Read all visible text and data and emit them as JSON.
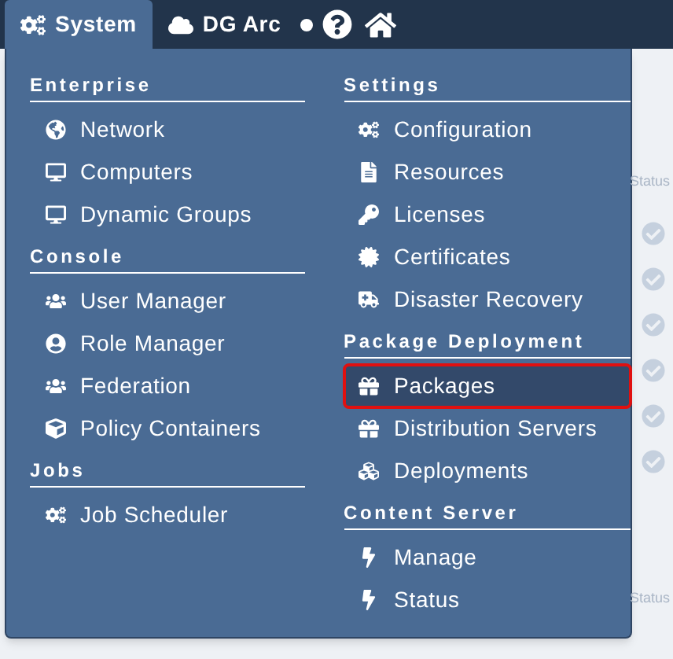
{
  "top_bar": {
    "items": [
      {
        "label": "System",
        "selected": true
      },
      {
        "label": "DG Arc",
        "selected": false
      }
    ]
  },
  "menu": {
    "columns": [
      [
        {
          "heading": "Enterprise",
          "items": [
            {
              "label": "Network",
              "selected": false,
              "outlined": false
            },
            {
              "label": "Computers",
              "selected": false,
              "outlined": false
            },
            {
              "label": "Dynamic Groups",
              "selected": false,
              "outlined": false
            }
          ]
        },
        {
          "heading": "Console",
          "items": [
            {
              "label": "User Manager",
              "selected": false,
              "outlined": false
            },
            {
              "label": "Role Manager",
              "selected": false,
              "outlined": false
            },
            {
              "label": "Federation",
              "selected": false,
              "outlined": false
            },
            {
              "label": "Policy Containers",
              "selected": false,
              "outlined": false
            }
          ]
        },
        {
          "heading": "Jobs",
          "items": [
            {
              "label": "Job Scheduler",
              "selected": false,
              "outlined": false
            }
          ]
        }
      ],
      [
        {
          "heading": "Settings",
          "items": [
            {
              "label": "Configuration",
              "selected": false,
              "outlined": false
            },
            {
              "label": "Resources",
              "selected": false,
              "outlined": false
            },
            {
              "label": "Licenses",
              "selected": false,
              "outlined": false
            },
            {
              "label": "Certificates",
              "selected": false,
              "outlined": false
            },
            {
              "label": "Disaster Recovery",
              "selected": false,
              "outlined": false
            }
          ]
        },
        {
          "heading": "Package Deployment",
          "items": [
            {
              "label": "Packages",
              "selected": true,
              "outlined": true
            },
            {
              "label": "Distribution Servers",
              "selected": false,
              "outlined": false
            },
            {
              "label": "Deployments",
              "selected": false,
              "outlined": false
            }
          ]
        },
        {
          "heading": "Content Server",
          "items": [
            {
              "label": "Manage",
              "selected": false,
              "outlined": false
            },
            {
              "label": "Status",
              "selected": false,
              "outlined": false
            }
          ]
        }
      ]
    ]
  },
  "background_page": {
    "labels": [
      "Status",
      "Status"
    ]
  }
}
